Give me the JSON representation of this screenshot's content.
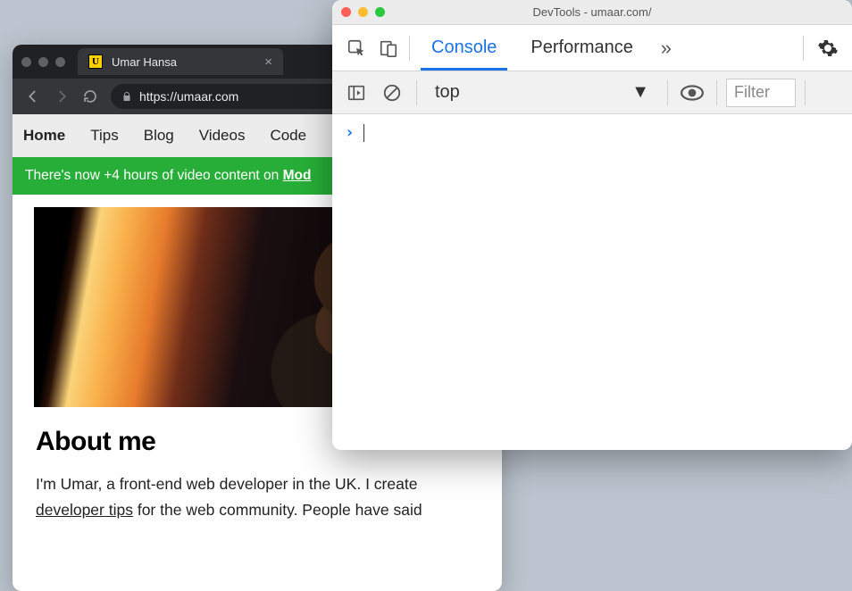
{
  "browser": {
    "tab_title": "Umar Hansa",
    "favicon_letter": "U",
    "url": "https://umaar.com",
    "nav": [
      "Home",
      "Tips",
      "Blog",
      "Videos",
      "Code"
    ],
    "nav_active_index": 0,
    "announcement_prefix": "There's now +4 hours of video content on ",
    "announcement_link": "Mod",
    "about_heading": "About me",
    "about_p1a": "I'm Umar, a front-end web developer in the UK. I create ",
    "about_p1_link": "developer tips",
    "about_p1b": " for the web community. People have said"
  },
  "devtools": {
    "window_title": "DevTools - umaar.com/",
    "tabs": {
      "console": "Console",
      "performance": "Performance"
    },
    "more_label": "»",
    "context_selector": "top",
    "filter_placeholder": "Filter",
    "prompt_symbol": "›",
    "traffic_colors": {
      "close": "#ff5f57",
      "min": "#febc2e",
      "max": "#28c840"
    }
  }
}
